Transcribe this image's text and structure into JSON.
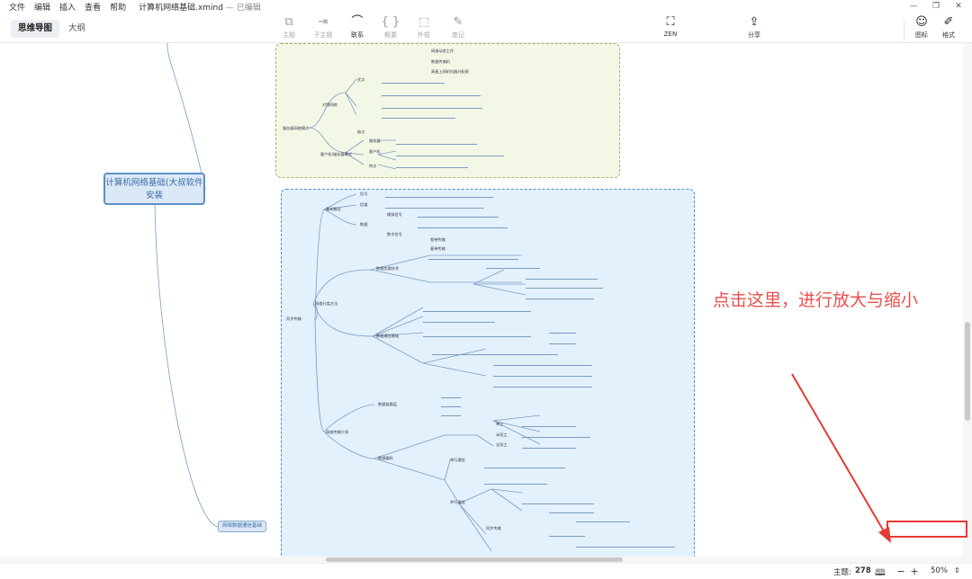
{
  "menu": {
    "items": [
      "文件",
      "编辑",
      "插入",
      "查看",
      "帮助"
    ],
    "doc_title": "计算机网络基础.xmind",
    "save_status": "— 已编辑"
  },
  "window_controls": [
    "—",
    "❐",
    "✕"
  ],
  "view_tabs": [
    {
      "label": "思维导图",
      "active": true
    },
    {
      "label": "大纲",
      "active": false
    }
  ],
  "tools": [
    {
      "label": "主题",
      "icon": "topic-icon"
    },
    {
      "label": "子主题",
      "icon": "subtopic-icon"
    },
    {
      "label": "联系",
      "icon": "relationship-icon"
    },
    {
      "label": "概要",
      "icon": "summary-icon"
    },
    {
      "label": "外框",
      "icon": "boundary-icon"
    },
    {
      "label": "笔记",
      "icon": "notes-icon"
    },
    {
      "label": "ZEN",
      "icon": "zen-icon"
    },
    {
      "label": "分享",
      "icon": "share-icon"
    },
    {
      "label": "图标",
      "icon": "emoji-icon"
    },
    {
      "label": "格式",
      "icon": "format-brush-icon"
    }
  ],
  "mindmap": {
    "root": "计算机网络基础(大叔软件安装",
    "left_branch": "网络数据通信基础",
    "green_topics": [
      "网络动态工作",
      "数据传输机",
      "高速上网机仪器分配表",
      "优点",
      "缺点",
      "对等网络",
      "服务器网络模式",
      "客户机/服务器模式",
      "服务器",
      "客户机",
      "特点"
    ],
    "blue_topics": [
      "基本概念",
      "网络分类方法",
      "数据交换技术",
      "数据通信基础",
      "网络传输介质",
      "数据编码",
      "信号",
      "信道",
      "数据",
      "模拟信号",
      "数字信号",
      "频带传输",
      "基带传输",
      "单工",
      "半双工",
      "全双工",
      "串行通信",
      "并行通信",
      "同步传输",
      "异步传输",
      "数据链路层"
    ]
  },
  "annotation": "点击这里，进行放大与缩小",
  "status": {
    "topics_label": "主题:",
    "topics_count": "278",
    "zoom_out": "−",
    "zoom_in": "+",
    "zoom_value": "50%"
  }
}
